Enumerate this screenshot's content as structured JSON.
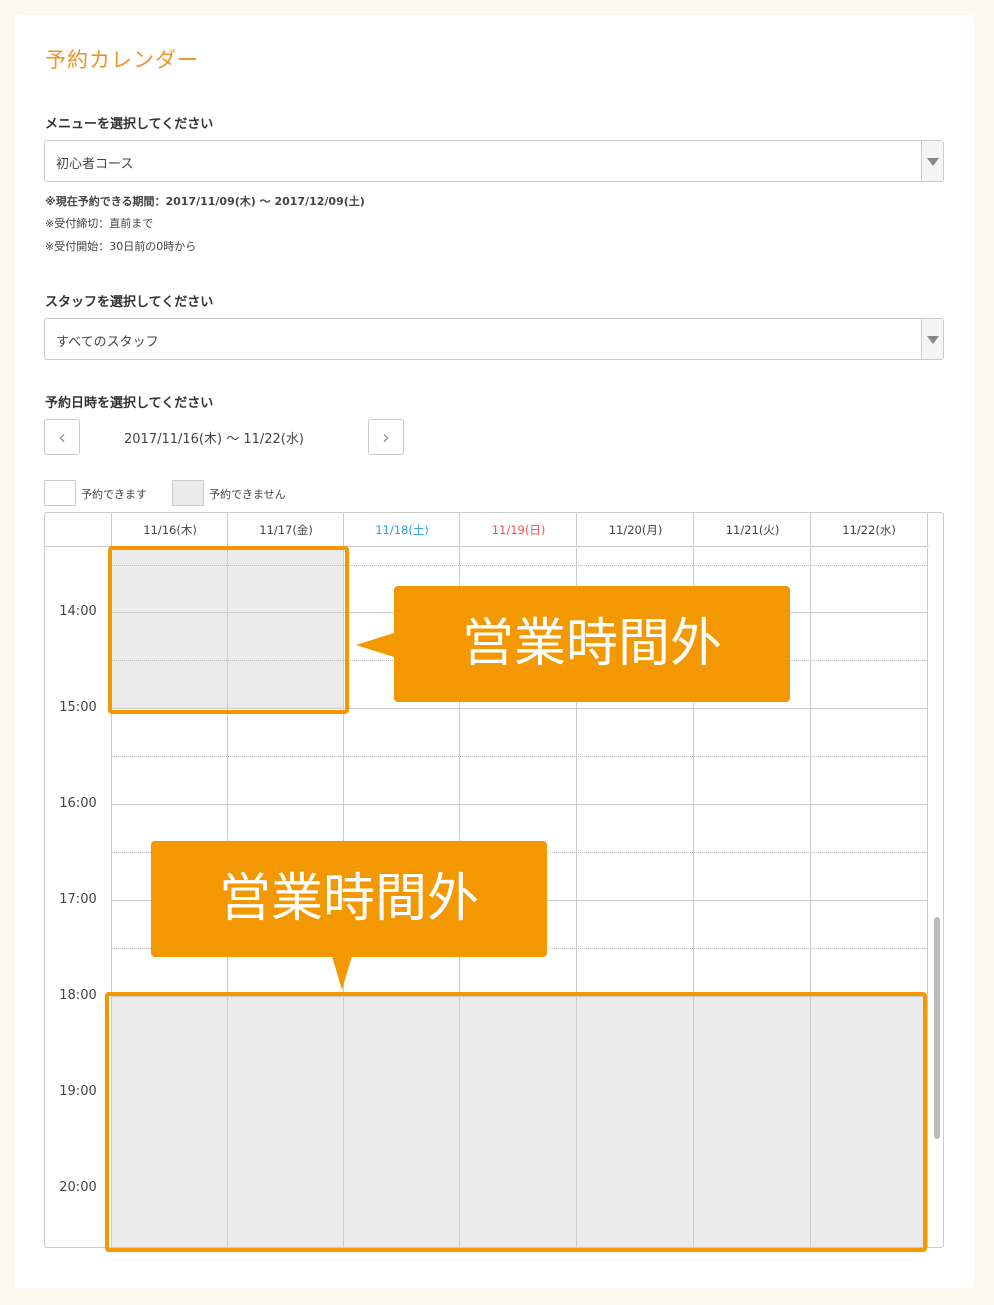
{
  "title": "予約カレンダー",
  "menu": {
    "label": "メニューを選択してください",
    "selected": "初心者コース"
  },
  "notes": [
    "※現在予約できる期間：2017/11/09(木) 〜 2017/12/09(土)",
    "※受付締切：直前まで",
    "※受付開始：30日前の0時から"
  ],
  "staff": {
    "label": "スタッフを選択してください",
    "selected": "すべてのスタッフ"
  },
  "datetime": {
    "label": "予約日時を選択してください",
    "prev_icon": "chevron-left-icon",
    "next_icon": "chevron-right-icon",
    "range": "2017/11/16(木) 〜 11/22(水)"
  },
  "legend": {
    "available": "予約できます",
    "unavailable": "予約できません"
  },
  "calendar": {
    "days": [
      "11/16(木)",
      "11/17(金)",
      "11/18(土)",
      "11/19(日)",
      "11/20(月)",
      "11/21(火)",
      "11/22(水)"
    ],
    "times": [
      "14:00",
      "15:00",
      "16:00",
      "17:00",
      "18:00",
      "19:00",
      "20:00"
    ]
  },
  "callouts": {
    "top": "営業時間外",
    "bottom": "営業時間外"
  },
  "colors": {
    "accent": "#f39800",
    "title": "#f0932b",
    "saturday": "#2a9fd6",
    "sunday": "#e8574b",
    "unavailable": "#ebebeb"
  }
}
